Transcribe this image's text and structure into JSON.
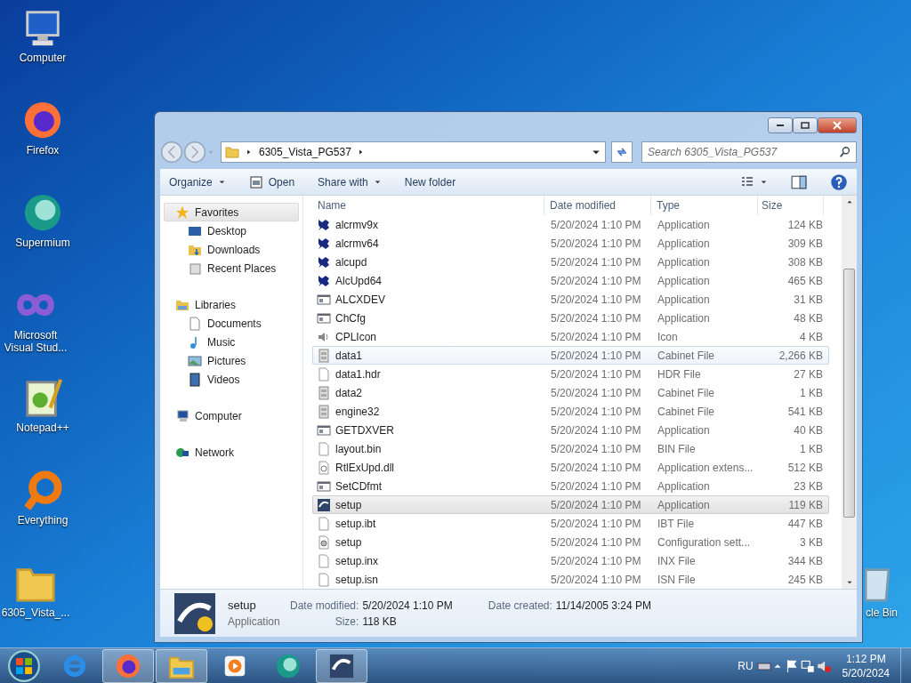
{
  "desktop_icons": [
    {
      "label": "Computer",
      "kind": "computer"
    },
    {
      "label": "Firefox",
      "kind": "firefox"
    },
    {
      "label": "Supermium",
      "kind": "supermium"
    },
    {
      "label": "Microsoft Visual Stud...",
      "kind": "vs"
    },
    {
      "label": "Notepad++",
      "kind": "notepad"
    },
    {
      "label": "Everything",
      "kind": "everything"
    },
    {
      "label": "6305_Vista_...",
      "kind": "folder"
    },
    {
      "label": "cle Bin",
      "kind": "bin"
    }
  ],
  "window": {
    "breadcrumb": "6305_Vista_PG537",
    "search": {
      "placeholder": "Search 6305_Vista_PG537"
    },
    "toolbar": [
      {
        "label": "Organize",
        "kind": "menu"
      },
      {
        "label": "Open",
        "kind": "open"
      },
      {
        "label": "Share with",
        "kind": "menu"
      },
      {
        "label": "New folder",
        "kind": "plain"
      }
    ],
    "sidebar": {
      "items": [
        {
          "label": "Favorites",
          "selected": true,
          "children": [
            {
              "label": "Desktop",
              "selected": false
            },
            {
              "label": "Downloads",
              "selected": false
            },
            {
              "label": "Recent Places",
              "selected": false
            }
          ]
        },
        {
          "label": "Libraries",
          "selected": false,
          "children": [
            {
              "label": "Documents",
              "selected": false
            },
            {
              "label": "Music",
              "selected": false
            },
            {
              "label": "Pictures",
              "selected": false
            },
            {
              "label": "Videos",
              "selected": false
            }
          ]
        },
        {
          "label": "Computer",
          "selected": false
        },
        {
          "label": "Network",
          "selected": false
        }
      ]
    },
    "table": {
      "columns": [
        "Name",
        "Date modified",
        "Type",
        "Size"
      ],
      "rows": [
        {
          "kind": "realtek",
          "name": "alcrmv9x",
          "date": "5/20/2024 1:10 PM",
          "type": "Application",
          "size": "124 KB",
          "selected": false,
          "hovered": false
        },
        {
          "kind": "realtek",
          "name": "alcrmv64",
          "date": "5/20/2024 1:10 PM",
          "type": "Application",
          "size": "309 KB",
          "selected": false,
          "hovered": false
        },
        {
          "kind": "realtek",
          "name": "alcupd",
          "date": "5/20/2024 1:10 PM",
          "type": "Application",
          "size": "308 KB",
          "selected": false,
          "hovered": false
        },
        {
          "kind": "realtek",
          "name": "AlcUpd64",
          "date": "5/20/2024 1:10 PM",
          "type": "Application",
          "size": "465 KB",
          "selected": false,
          "hovered": false
        },
        {
          "kind": "app",
          "name": "ALCXDEV",
          "date": "5/20/2024 1:10 PM",
          "type": "Application",
          "size": "31 KB",
          "selected": false,
          "hovered": false
        },
        {
          "kind": "app",
          "name": "ChCfg",
          "date": "5/20/2024 1:10 PM",
          "type": "Application",
          "size": "48 KB",
          "selected": false,
          "hovered": false
        },
        {
          "kind": "speaker",
          "name": "CPLIcon",
          "date": "5/20/2024 1:10 PM",
          "type": "Icon",
          "size": "4 KB",
          "selected": false,
          "hovered": false
        },
        {
          "kind": "cabinet",
          "name": "data1",
          "date": "5/20/2024 1:10 PM",
          "type": "Cabinet File",
          "size": "2,266 KB",
          "selected": false,
          "hovered": true
        },
        {
          "kind": "blank",
          "name": "data1.hdr",
          "date": "5/20/2024 1:10 PM",
          "type": "HDR File",
          "size": "27 KB",
          "selected": false,
          "hovered": false
        },
        {
          "kind": "cabinet",
          "name": "data2",
          "date": "5/20/2024 1:10 PM",
          "type": "Cabinet File",
          "size": "1 KB",
          "selected": false,
          "hovered": false
        },
        {
          "kind": "cabinet",
          "name": "engine32",
          "date": "5/20/2024 1:10 PM",
          "type": "Cabinet File",
          "size": "541 KB",
          "selected": false,
          "hovered": false
        },
        {
          "kind": "app",
          "name": "GETDXVER",
          "date": "5/20/2024 1:10 PM",
          "type": "Application",
          "size": "40 KB",
          "selected": false,
          "hovered": false
        },
        {
          "kind": "blank",
          "name": "layout.bin",
          "date": "5/20/2024 1:10 PM",
          "type": "BIN File",
          "size": "1 KB",
          "selected": false,
          "hovered": false
        },
        {
          "kind": "dll",
          "name": "RtlExUpd.dll",
          "date": "5/20/2024 1:10 PM",
          "type": "Application extens...",
          "size": "512 KB",
          "selected": false,
          "hovered": false
        },
        {
          "kind": "app",
          "name": "SetCDfmt",
          "date": "5/20/2024 1:10 PM",
          "type": "Application",
          "size": "23 KB",
          "selected": false,
          "hovered": false
        },
        {
          "kind": "setup",
          "name": "setup",
          "date": "5/20/2024 1:10 PM",
          "type": "Application",
          "size": "119 KB",
          "selected": true,
          "hovered": false
        },
        {
          "kind": "blank",
          "name": "setup.ibt",
          "date": "5/20/2024 1:10 PM",
          "type": "IBT File",
          "size": "447 KB",
          "selected": false,
          "hovered": false
        },
        {
          "kind": "config",
          "name": "setup",
          "date": "5/20/2024 1:10 PM",
          "type": "Configuration sett...",
          "size": "3 KB",
          "selected": false,
          "hovered": false
        },
        {
          "kind": "blank",
          "name": "setup.inx",
          "date": "5/20/2024 1:10 PM",
          "type": "INX File",
          "size": "344 KB",
          "selected": false,
          "hovered": false
        },
        {
          "kind": "blank",
          "name": "setup.isn",
          "date": "5/20/2024 1:10 PM",
          "type": "ISN File",
          "size": "245 KB",
          "selected": false,
          "hovered": false
        }
      ]
    },
    "details": {
      "name": "setup",
      "type": "Application",
      "fields": [
        {
          "label": "Date modified:",
          "value": "5/20/2024 1:10 PM"
        },
        {
          "label": "Size:",
          "value": "118 KB"
        },
        {
          "label": "Date created:",
          "value": "11/14/2005 3:24 PM"
        }
      ]
    }
  },
  "taskbar": {
    "items": [
      {
        "kind": "ie",
        "open": false
      },
      {
        "kind": "firefox",
        "open": true
      },
      {
        "kind": "explorer",
        "open": true
      },
      {
        "kind": "media",
        "open": false
      },
      {
        "kind": "supermium",
        "open": false
      },
      {
        "kind": "setup",
        "open": true
      }
    ],
    "language": "RU",
    "time": "1:12 PM",
    "date": "5/20/2024"
  }
}
